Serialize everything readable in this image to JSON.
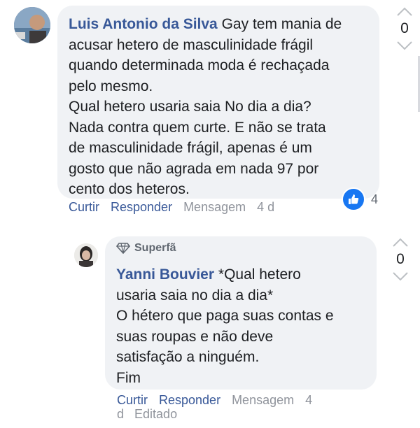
{
  "comments": [
    {
      "author": "Luis Antonio da Silva",
      "text_lines": [
        "Gay tem mania de",
        "acusar hetero de masculinidade frágil",
        "quando determinada moda é rechaçada",
        "pelo mesmo.",
        "Qual hetero usaria saia No dia a dia?",
        "Nada contra quem curte. E não se trata",
        "de masculinidade frágil, apenas é um",
        "gosto que não agrada em nada 97 por",
        "cento dos heteros."
      ],
      "actions": {
        "like": "Curtir",
        "reply": "Responder",
        "message": "Mensagem",
        "time": "4 d"
      },
      "reaction": {
        "icon": "thumbs-up-icon",
        "count": "4",
        "color": "#1877f2"
      },
      "vote_count": "0"
    },
    {
      "badge": "Superfã",
      "badge_icon": "diamond-icon",
      "author": "Yanni Bouvier",
      "text_lines": [
        "*Qual hetero",
        "usaria saia no dia a dia*",
        "O hétero que paga suas contas e",
        "suas roupas e não deve",
        "satisfação a ninguém.",
        "Fim"
      ],
      "actions": {
        "like": "Curtir",
        "reply": "Responder",
        "message": "Mensagem",
        "time": "4",
        "time_cont": "d",
        "edited": "Editado"
      },
      "vote_count": "0"
    }
  ],
  "colors": {
    "link": "#385898",
    "muted": "#90949c",
    "bubble": "#f0f2f5",
    "text": "#1c1e21"
  }
}
